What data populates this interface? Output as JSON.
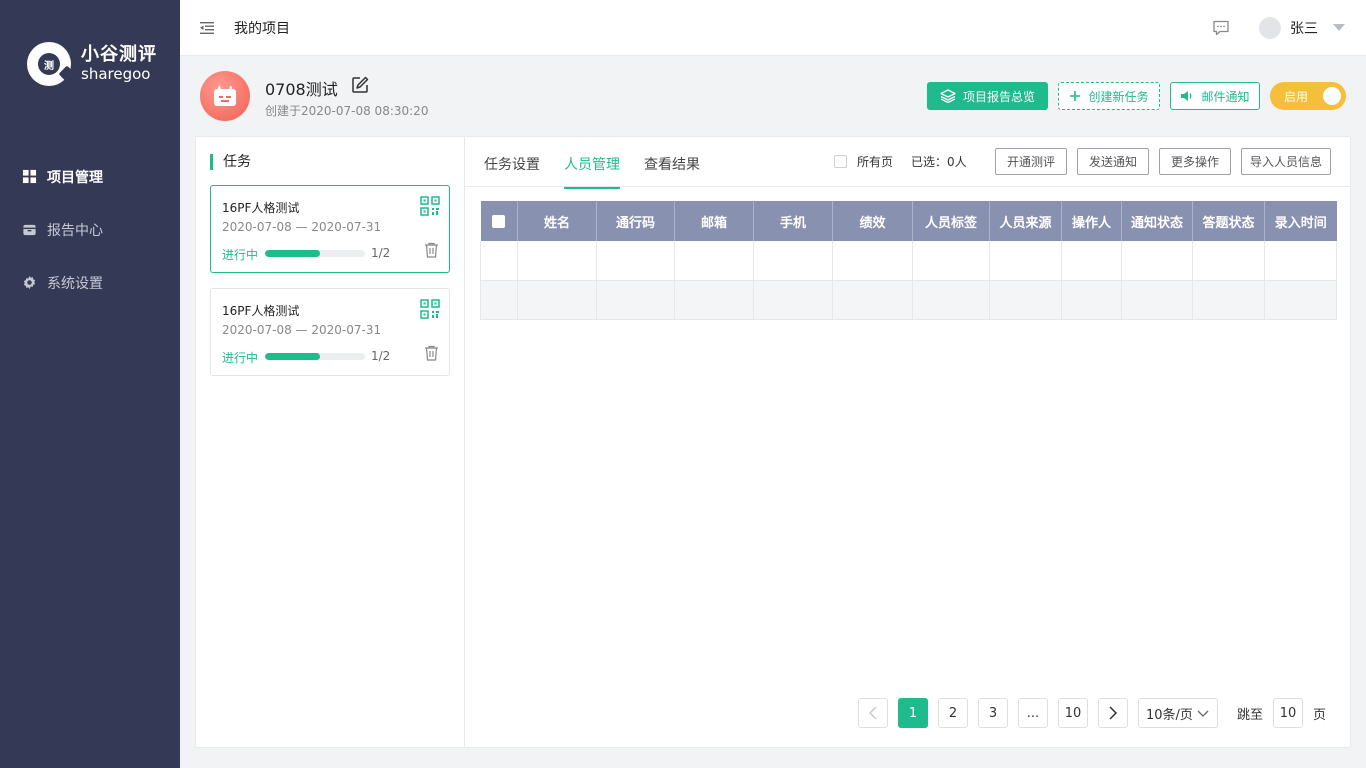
{
  "sidebar": {
    "logo_cn": "小谷测评",
    "logo_en": "sharegoo",
    "logo_mark": "测",
    "items": [
      {
        "label": "项目管理",
        "icon": "grid-icon"
      },
      {
        "label": "报告中心",
        "icon": "box-icon"
      },
      {
        "label": "系统设置",
        "icon": "gear-icon"
      }
    ]
  },
  "topbar": {
    "title": "我的项目",
    "user_name": "张三"
  },
  "project": {
    "name": "0708测试",
    "created": "创建于2020-07-08 08:30:20",
    "actions": {
      "report_overview": "项目报告总览",
      "create_task": "创建新任务",
      "mail_notify": "邮件通知",
      "toggle_label": "启用"
    }
  },
  "tasks": {
    "heading": "任务",
    "items": [
      {
        "title": "16PF人格测试",
        "dates": "2020-07-08 — 2020-07-31",
        "status": "进行中",
        "count": "1/2",
        "progress": 0.55
      },
      {
        "title": "16PF人格测试",
        "dates": "2020-07-08 — 2020-07-31",
        "status": "进行中",
        "count": "1/2",
        "progress": 0.55
      }
    ]
  },
  "content": {
    "tabs": [
      "任务设置",
      "人员管理",
      "查看结果"
    ],
    "active_tab": 1,
    "all_pages_label": "所有页",
    "selected_label": "已选：0人",
    "buttons": [
      "开通测评",
      "发送通知",
      "更多操作",
      "导入人员信息"
    ],
    "table": {
      "columns": [
        "姓名",
        "通行码",
        "邮箱",
        "手机",
        "绩效",
        "人员标签",
        "人员来源",
        "操作人",
        "通知状态",
        "答题状态",
        "录入时间"
      ],
      "rows": 2
    },
    "pager": {
      "pages": [
        "1",
        "2",
        "3",
        "...",
        "10"
      ],
      "current": "1",
      "page_size": "10条/页",
      "jump_label": "跳至",
      "jump_value": "10",
      "page_suffix": "页"
    }
  },
  "colors": {
    "sidebar_bg": "#343a55",
    "accent": "#1fbb8d",
    "toggle": "#f5be3b",
    "table_header": "#8892b0"
  }
}
